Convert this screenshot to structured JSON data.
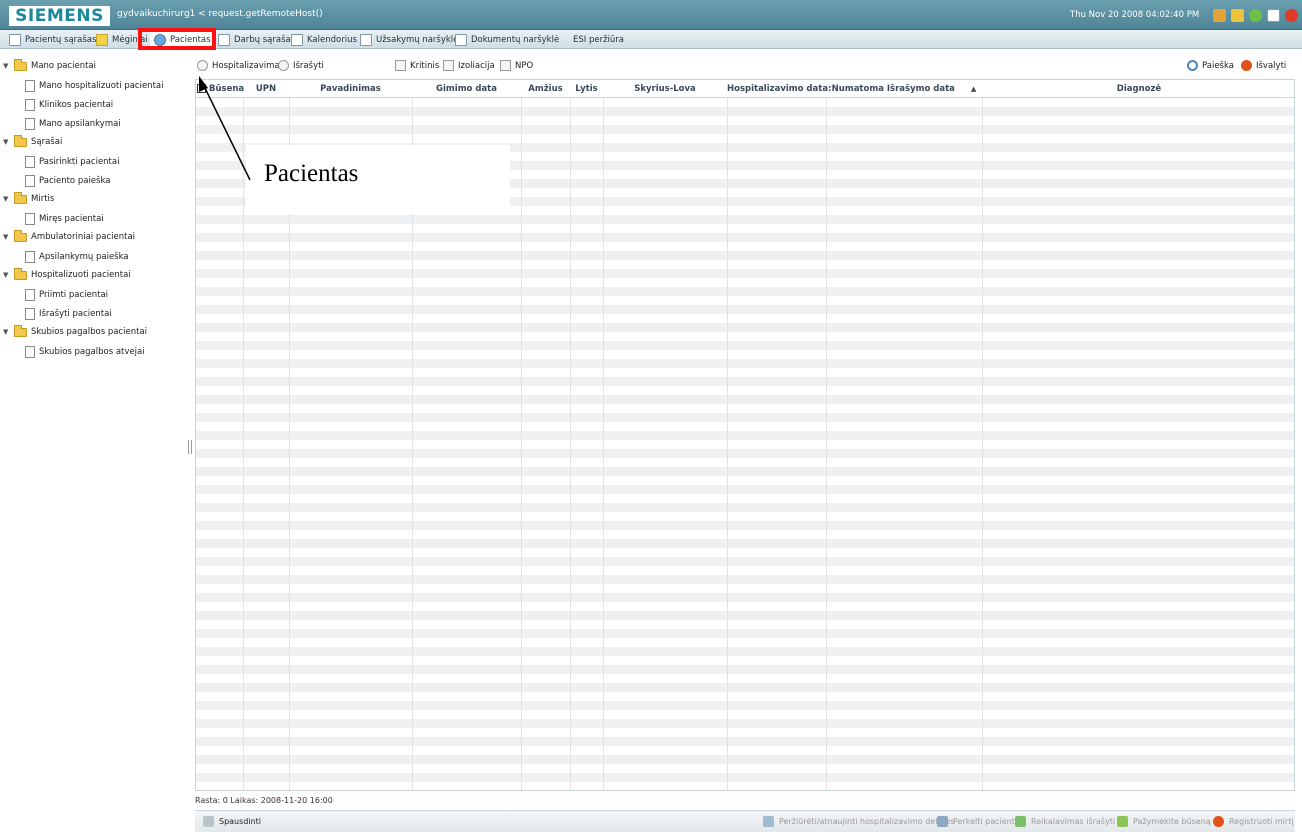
{
  "header": {
    "logo": "SIEMENS",
    "user_info": "gydvaikuchirurg1   < request.getRemoteHost()",
    "datetime": "Thu Nov 20 2008 04:02:40 PM",
    "icons": [
      "users-icon",
      "key-icon",
      "help-icon",
      "window-icon",
      "close-icon"
    ]
  },
  "tabs": [
    {
      "label": "Pacientų sąrašas",
      "icon": "grid-icon"
    },
    {
      "label": "Mėginiai",
      "icon": "flask-icon"
    },
    {
      "label": "Pacientas",
      "icon": "person-icon",
      "active": true
    },
    {
      "label": "Darbų sąrašas",
      "icon": "list-icon"
    },
    {
      "label": "Kalendorius",
      "icon": "calendar-icon"
    },
    {
      "label": "Užsakymų naršyklė",
      "icon": "document-icon"
    },
    {
      "label": "Dokumentų naršyklė",
      "icon": "document-plus-icon"
    },
    {
      "label": "ESI peržiūra",
      "icon": ""
    }
  ],
  "sidebar": {
    "groups": [
      {
        "label": "Mano pacientai",
        "items": [
          "Mano hospitalizuoti pacientai",
          "Klinikos pacientai",
          "Mano apsilankymai"
        ]
      },
      {
        "label": "Sąrašai",
        "items": [
          "Pasirinkti pacientai",
          "Paciento paieška"
        ]
      },
      {
        "label": "Mirtis",
        "items": [
          "Miręs pacientai"
        ]
      },
      {
        "label": "Ambulatoriniai pacientai",
        "items": [
          "Apsilankymų paieška"
        ]
      },
      {
        "label": "Hospitalizuoti pacientai",
        "items": [
          "Priimti pacientai",
          "Išrašyti pacientai"
        ]
      },
      {
        "label": "Skubios pagalbos pacientai",
        "items": [
          "Skubios pagalbos atvejai"
        ]
      }
    ]
  },
  "filters": {
    "radio_hospitalized": "Hospitalizavimas",
    "radio_discharged": "Išrašyti",
    "check_critical": "Kritinis",
    "check_isolation": "Izoliacija",
    "check_npo": "NPO",
    "search_label": "Paieška",
    "clear_label": "Išvalyti"
  },
  "table": {
    "columns": [
      "Būsena",
      "UPN",
      "Pavadinimas",
      "Gimimo data",
      "Amžius",
      "Lytis",
      "Skyrius-Lova",
      "Hospitalizavimo data:",
      "Numatoma Išrašymo data",
      "Diagnozė"
    ],
    "sort_indicator": "▲",
    "rows": []
  },
  "status": {
    "text": "Rasta: 0  Laikas: 2008-11-20 16:00"
  },
  "bottom_toolbar": {
    "print_label": "Spausdinti",
    "actions": [
      "Peržiūrėti/atnaujinti hospitalizavimo detales",
      "Perkelti pacientą",
      "Reikalavimas išrašyti",
      "Pažymėkite būseną",
      "Registruoti mirtį"
    ]
  },
  "annotation": {
    "label": "Pacientas"
  },
  "colors": {
    "header": "#5a8fa0",
    "logo_text": "#1a8a9b",
    "highlight": "#ff1010"
  }
}
